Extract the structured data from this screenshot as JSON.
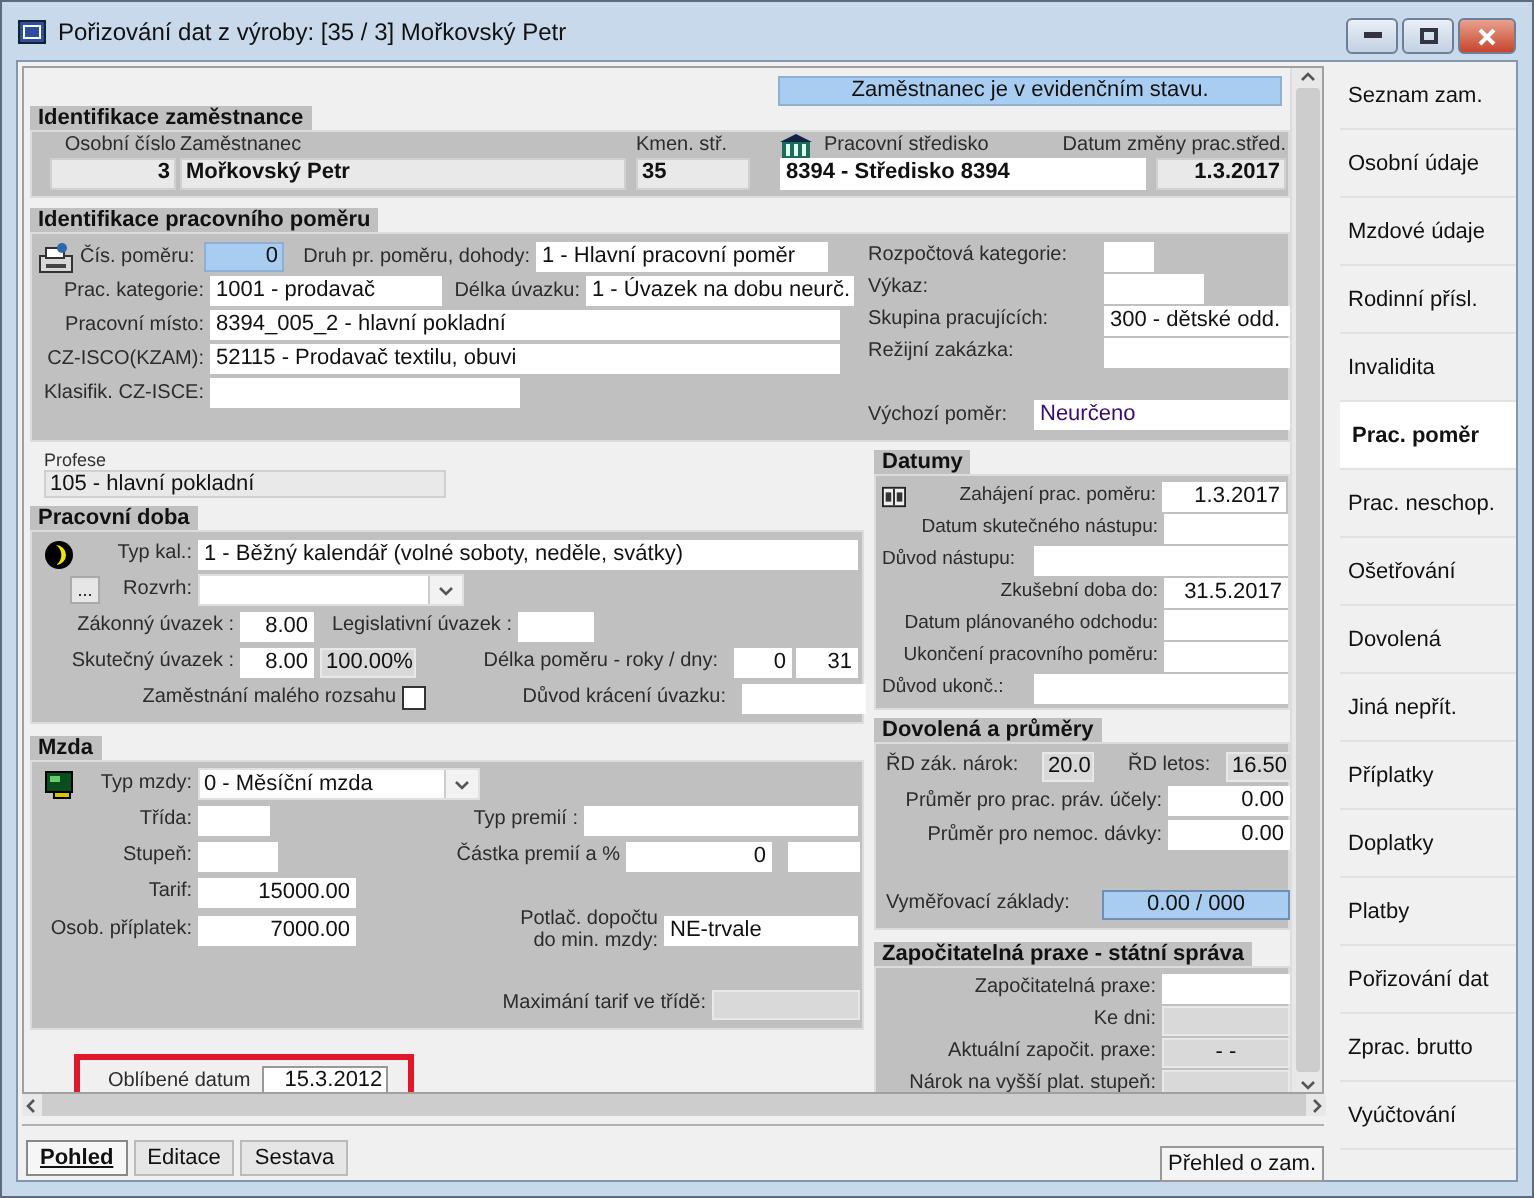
{
  "window": {
    "title": "Pořizování dat z výroby: [35 / 3] Mořkovský Petr"
  },
  "status_banner": "Zaměstnanec je v evidenčním stavu.",
  "employee": {
    "title": "Identifikace zaměstnance",
    "personal_number": {
      "label": "Osobní číslo",
      "value": "3"
    },
    "employee_name": {
      "label": "Zaměstnanec",
      "value": "Mořkovský Petr"
    },
    "home_centre": {
      "label": "Kmen. stř.",
      "value": "35"
    },
    "work_centre": {
      "label": "Pracovní středisko",
      "value": "8394 - Středisko 8394"
    },
    "centre_change_date": {
      "label": "Datum změny prac.střed.",
      "value": "1.3.2017"
    }
  },
  "employment": {
    "title": "Identifikace pracovního poměru",
    "number": {
      "label": "Čís. poměru:",
      "value": "0"
    },
    "type": {
      "label": "Druh pr. poměru, dohody:",
      "value": "1 - Hlavní pracovní poměr"
    },
    "category": {
      "label": "Prac. kategorie:",
      "value": "1001 - prodavač"
    },
    "duration": {
      "label": "Délka úvazku:",
      "value": "1 - Úvazek na dobu neurč."
    },
    "position": {
      "label": "Pracovní místo:",
      "value": "8394_005_2 - hlavní pokladní"
    },
    "cz_isco": {
      "label": "CZ-ISCO(KZAM):",
      "value": "52115 - Prodavač textilu, obuvi"
    },
    "cz_isce": {
      "label": "Klasifik. CZ-ISCE:"
    },
    "budget_category": {
      "label": "Rozpočtová kategorie:"
    },
    "report": {
      "label": "Výkaz:"
    },
    "worker_group": {
      "label": "Skupina pracujících:",
      "value": "300 - dětské odd."
    },
    "overhead_order": {
      "label": "Režijní zakázka:"
    },
    "default_relation": {
      "label": "Výchozí poměr:",
      "value": "Neurčeno"
    }
  },
  "profession": {
    "label": "Profese",
    "value": "105 - hlavní pokladní"
  },
  "working_time": {
    "title": "Pracovní doba",
    "calendar": {
      "label": "Typ kal.:",
      "value": "1 - Běžný kalendář (volné soboty, neděle, svátky)"
    },
    "schedule": {
      "button": "...",
      "label": "Rozvrh:"
    },
    "legal_load": {
      "label": "Zákonný úvazek :",
      "value": "8.00"
    },
    "legislative_load": {
      "label": "Legislativní úvazek :"
    },
    "actual_load": {
      "label": "Skutečný úvazek :",
      "value": "8.00",
      "percent": "100.00%"
    },
    "length": {
      "label": "Délka poměru - roky / dny:",
      "years": "0",
      "days": "31"
    },
    "small_scope": {
      "label": "Zaměstnání malého rozsahu",
      "checked": false
    },
    "reduction_reason": {
      "label": "Důvod krácení úvazku:"
    }
  },
  "wage": {
    "title": "Mzda",
    "wage_type": {
      "label": "Typ mzdy:",
      "value": "0 - Měsíční mzda"
    },
    "class": {
      "label": "Třída:"
    },
    "bonus_type": {
      "label": "Typ premií :"
    },
    "grade": {
      "label": "Stupeň:"
    },
    "bonus_amount": {
      "label": "Částka premií a %",
      "value": "0"
    },
    "tariff": {
      "label": "Tarif:",
      "value": "15000.00"
    },
    "personal_bonus": {
      "label": "Osob. příplatek:",
      "value": "7000.00"
    },
    "min_wage": {
      "label_lines": [
        "Potlač. dopočtu",
        "do min. mzdy:"
      ],
      "value": "NE-trvale"
    },
    "max_tariff": {
      "label": "Maximání tarif ve třídě:"
    }
  },
  "favourite_date": {
    "label": "Oblíbené datum",
    "value": "15.3.2012"
  },
  "dates": {
    "title": "Datumy",
    "rows": [
      {
        "kind": "date",
        "label": "Zahájení prac. poměru:",
        "value": "1.3.2017"
      },
      {
        "kind": "date",
        "label": "Datum skutečného nástupu:"
      },
      {
        "kind": "wide",
        "label": "Důvod nástupu:"
      },
      {
        "kind": "date",
        "label": "Zkušební doba do:",
        "value": "31.5.2017"
      },
      {
        "kind": "date",
        "label": "Datum plánovaného odchodu:"
      },
      {
        "kind": "date",
        "label": "Ukončení pracovního poměru:"
      },
      {
        "kind": "wide",
        "label": "Důvod ukonč.:"
      }
    ]
  },
  "leave": {
    "title": "Dovolená a průměry",
    "entitlement": {
      "label": "ŘD zák. nárok:",
      "value": "20.0"
    },
    "this_year": {
      "label": "ŘD letos:",
      "value": "16.50"
    },
    "averages": [
      {
        "label": "Průměr pro prac. práv. účely:",
        "value": "0.00"
      },
      {
        "label": "Průměr pro nemoc. dávky:",
        "value": "0.00"
      }
    ],
    "assessment_base": {
      "label": "Vyměřovací základy:",
      "value": "0.00 / 000"
    }
  },
  "practice": {
    "title": "Započitatelná praxe - státní správa",
    "rows": [
      {
        "kind": "input",
        "label": "Započitatelná praxe:"
      },
      {
        "kind": "readonly",
        "label": "Ke dni:"
      },
      {
        "kind": "readonly",
        "label": "Aktuální započit. praxe:",
        "value": "-   -"
      },
      {
        "kind": "readonly",
        "label": "Nárok na vyšší plat. stupeň:"
      }
    ]
  },
  "bottom_tabs": [
    {
      "label": "Pohled",
      "selected": true
    },
    {
      "label": "Editace",
      "selected": false
    },
    {
      "label": "Sestava",
      "selected": false
    }
  ],
  "overview_button": "Přehled o zam.",
  "sidebar": {
    "items": [
      {
        "label": "Seznam zam.",
        "selected": false
      },
      {
        "label": "Osobní údaje",
        "selected": false
      },
      {
        "label": "Mzdové údaje",
        "selected": false
      },
      {
        "label": "Rodinní přísl.",
        "selected": false
      },
      {
        "label": "Invalidita",
        "selected": false
      },
      {
        "label": "Prac. poměr",
        "selected": true
      },
      {
        "label": "Prac. neschop.",
        "selected": false
      },
      {
        "label": "Ošetřování",
        "selected": false
      },
      {
        "label": "Dovolená",
        "selected": false
      },
      {
        "label": "Jiná nepřít.",
        "selected": false
      },
      {
        "label": "Příplatky",
        "selected": false
      },
      {
        "label": "Doplatky",
        "selected": false
      },
      {
        "label": "Platby",
        "selected": false
      },
      {
        "label": "Pořizování dat",
        "selected": false
      },
      {
        "label": "Zprac. brutto",
        "selected": false
      },
      {
        "label": "Vyúčtování",
        "selected": false
      }
    ]
  }
}
